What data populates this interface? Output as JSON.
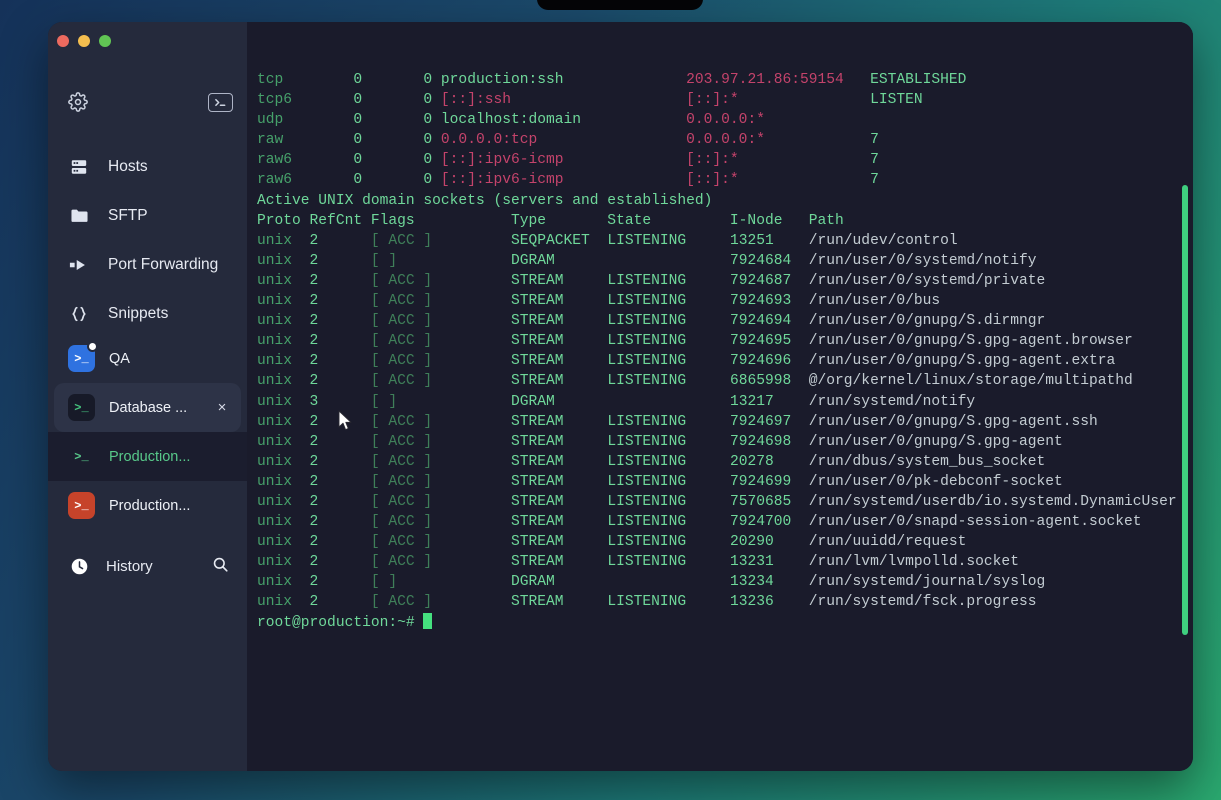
{
  "window": {
    "traffic_lights": [
      "close",
      "minimize",
      "maximize"
    ],
    "colors": {
      "close": "#ed6a5f",
      "minimize": "#f4be4f",
      "maximize": "#61c554",
      "accent_green": "#3fcf7f",
      "active_tab_green": "#58c98a"
    }
  },
  "sidebar": {
    "top_actions": [
      {
        "name": "settings",
        "icon": "gear-icon"
      },
      {
        "name": "new-terminal",
        "icon": "terminal-icon"
      }
    ],
    "nav": [
      {
        "label": "Hosts",
        "icon": "server-rack-icon"
      },
      {
        "label": "SFTP",
        "icon": "folder-icon"
      },
      {
        "label": "Port Forwarding",
        "icon": "arrow-forward-icon"
      },
      {
        "label": "Snippets",
        "icon": "curly-braces-icon"
      }
    ],
    "tabs": [
      {
        "label": "QA",
        "icon": "terminal-icon",
        "icon_color": "blue",
        "badge": true,
        "closable": false,
        "state": "normal"
      },
      {
        "label": "Database ...",
        "icon": "terminal-icon",
        "icon_color": "dark",
        "badge": false,
        "closable": true,
        "close_label": "×",
        "state": "selected"
      },
      {
        "label": "Production...",
        "icon": "terminal-icon",
        "icon_color": "plain",
        "badge": false,
        "closable": false,
        "state": "active"
      },
      {
        "label": "Production...",
        "icon": "terminal-icon",
        "icon_color": "red",
        "badge": false,
        "closable": false,
        "state": "normal"
      }
    ],
    "history": {
      "label": "History",
      "icon": "clock-icon",
      "search_icon": "search-icon"
    }
  },
  "terminal": {
    "prompt": "root@production:~#",
    "net_rows": [
      {
        "proto": "tcp",
        "recvq": "0",
        "sendq": "0",
        "local": "production:ssh",
        "foreign": "203.97.21.86:59154",
        "state": "ESTABLISHED"
      },
      {
        "proto": "tcp6",
        "recvq": "0",
        "sendq": "0",
        "local": "[::]:ssh",
        "foreign": "[::]:*",
        "state": "LISTEN"
      },
      {
        "proto": "udp",
        "recvq": "0",
        "sendq": "0",
        "local": "localhost:domain",
        "foreign": "0.0.0.0:*",
        "state": ""
      },
      {
        "proto": "raw",
        "recvq": "0",
        "sendq": "0",
        "local": "0.0.0.0:tcp",
        "foreign": "0.0.0.0:*",
        "state": "7"
      },
      {
        "proto": "raw6",
        "recvq": "0",
        "sendq": "0",
        "local": "[::]:ipv6-icmp",
        "foreign": "[::]:*",
        "state": "7"
      },
      {
        "proto": "raw6",
        "recvq": "0",
        "sendq": "0",
        "local": "[::]:ipv6-icmp",
        "foreign": "[::]:*",
        "state": "7"
      }
    ],
    "unix_header_text": "Active UNIX domain sockets (servers and established)",
    "unix_columns": [
      "Proto",
      "RefCnt",
      "Flags",
      "Type",
      "State",
      "I-Node",
      "Path"
    ],
    "unix_rows": [
      {
        "proto": "unix",
        "refcnt": "2",
        "flags": "[ ACC ]",
        "type": "SEQPACKET",
        "state": "LISTENING",
        "inode": "13251",
        "path": "/run/udev/control"
      },
      {
        "proto": "unix",
        "refcnt": "2",
        "flags": "[ ]",
        "type": "DGRAM",
        "state": "",
        "inode": "7924684",
        "path": "/run/user/0/systemd/notify"
      },
      {
        "proto": "unix",
        "refcnt": "2",
        "flags": "[ ACC ]",
        "type": "STREAM",
        "state": "LISTENING",
        "inode": "7924687",
        "path": "/run/user/0/systemd/private"
      },
      {
        "proto": "unix",
        "refcnt": "2",
        "flags": "[ ACC ]",
        "type": "STREAM",
        "state": "LISTENING",
        "inode": "7924693",
        "path": "/run/user/0/bus"
      },
      {
        "proto": "unix",
        "refcnt": "2",
        "flags": "[ ACC ]",
        "type": "STREAM",
        "state": "LISTENING",
        "inode": "7924694",
        "path": "/run/user/0/gnupg/S.dirmngr"
      },
      {
        "proto": "unix",
        "refcnt": "2",
        "flags": "[ ACC ]",
        "type": "STREAM",
        "state": "LISTENING",
        "inode": "7924695",
        "path": "/run/user/0/gnupg/S.gpg-agent.browser"
      },
      {
        "proto": "unix",
        "refcnt": "2",
        "flags": "[ ACC ]",
        "type": "STREAM",
        "state": "LISTENING",
        "inode": "7924696",
        "path": "/run/user/0/gnupg/S.gpg-agent.extra"
      },
      {
        "proto": "unix",
        "refcnt": "2",
        "flags": "[ ACC ]",
        "type": "STREAM",
        "state": "LISTENING",
        "inode": "6865998",
        "path": "@/org/kernel/linux/storage/multipathd"
      },
      {
        "proto": "unix",
        "refcnt": "3",
        "flags": "[ ]",
        "type": "DGRAM",
        "state": "",
        "inode": "13217",
        "path": "/run/systemd/notify"
      },
      {
        "proto": "unix",
        "refcnt": "2",
        "flags": "[ ACC ]",
        "type": "STREAM",
        "state": "LISTENING",
        "inode": "7924697",
        "path": "/run/user/0/gnupg/S.gpg-agent.ssh"
      },
      {
        "proto": "unix",
        "refcnt": "2",
        "flags": "[ ACC ]",
        "type": "STREAM",
        "state": "LISTENING",
        "inode": "7924698",
        "path": "/run/user/0/gnupg/S.gpg-agent"
      },
      {
        "proto": "unix",
        "refcnt": "2",
        "flags": "[ ACC ]",
        "type": "STREAM",
        "state": "LISTENING",
        "inode": "20278",
        "path": "/run/dbus/system_bus_socket"
      },
      {
        "proto": "unix",
        "refcnt": "2",
        "flags": "[ ACC ]",
        "type": "STREAM",
        "state": "LISTENING",
        "inode": "7924699",
        "path": "/run/user/0/pk-debconf-socket"
      },
      {
        "proto": "unix",
        "refcnt": "2",
        "flags": "[ ACC ]",
        "type": "STREAM",
        "state": "LISTENING",
        "inode": "7570685",
        "path": "/run/systemd/userdb/io.systemd.DynamicUser"
      },
      {
        "proto": "unix",
        "refcnt": "2",
        "flags": "[ ACC ]",
        "type": "STREAM",
        "state": "LISTENING",
        "inode": "7924700",
        "path": "/run/user/0/snapd-session-agent.socket"
      },
      {
        "proto": "unix",
        "refcnt": "2",
        "flags": "[ ACC ]",
        "type": "STREAM",
        "state": "LISTENING",
        "inode": "20290",
        "path": "/run/uuidd/request"
      },
      {
        "proto": "unix",
        "refcnt": "2",
        "flags": "[ ACC ]",
        "type": "STREAM",
        "state": "LISTENING",
        "inode": "13231",
        "path": "/run/lvm/lvmpolld.socket"
      },
      {
        "proto": "unix",
        "refcnt": "2",
        "flags": "[ ]",
        "type": "DGRAM",
        "state": "",
        "inode": "13234",
        "path": "/run/systemd/journal/syslog"
      },
      {
        "proto": "unix",
        "refcnt": "2",
        "flags": "[ ACC ]",
        "type": "STREAM",
        "state": "LISTENING",
        "inode": "13236",
        "path": "/run/systemd/fsck.progress"
      }
    ]
  }
}
